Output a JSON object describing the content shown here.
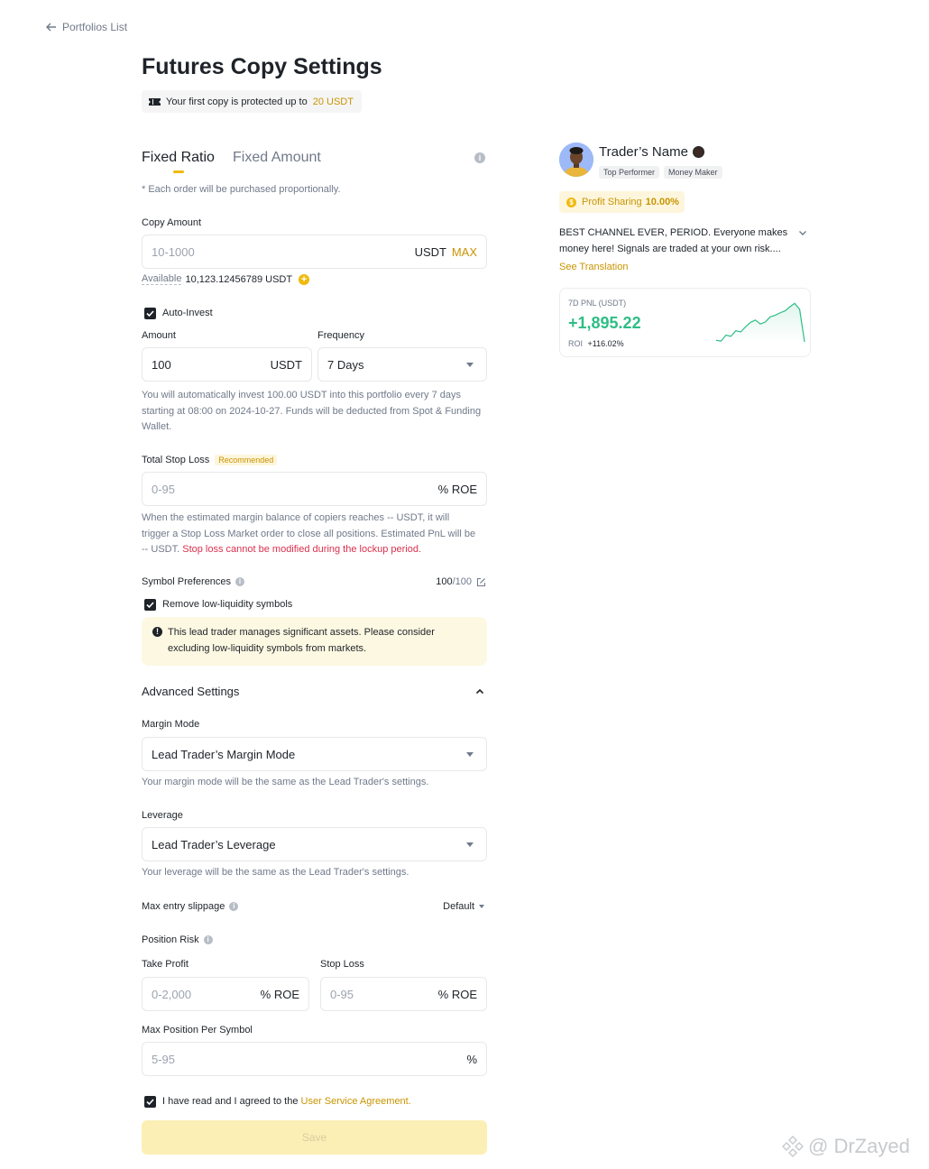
{
  "nav": {
    "back_label": "Portfolios List"
  },
  "page": {
    "title": "Futures Copy Settings",
    "protect_text": "Your first copy is protected up to",
    "protect_amount": "20 USDT"
  },
  "tabs": {
    "active": "Fixed Ratio",
    "inactive": "Fixed Amount"
  },
  "note": "* Each order will be purchased proportionally.",
  "copy_amount": {
    "label": "Copy Amount",
    "placeholder": "10-1000",
    "unit": "USDT",
    "max": "MAX",
    "available_label": "Available",
    "available_value": "10,123.12456789 USDT"
  },
  "auto_invest": {
    "label": "Auto-Invest",
    "amount_label": "Amount",
    "amount_value": "100",
    "amount_unit": "USDT",
    "frequency_label": "Frequency",
    "frequency_value": "7 Days",
    "helper": "You will automatically invest 100.00 USDT into this portfolio every 7 days starting at 08:00 on 2024-10-27. Funds will be deducted from Spot & Funding Wallet."
  },
  "stop_loss": {
    "label": "Total Stop Loss",
    "badge": "Recommended",
    "placeholder": "0-95",
    "unit": "% ROE",
    "helper": "When the estimated margin balance of copiers reaches -- USDT, it will trigger a Stop Loss Market order to close all positions. Estimated PnL will be -- USDT.",
    "warning": "Stop loss cannot be modified during the lockup period."
  },
  "symbols": {
    "label": "Symbol Preferences",
    "count_value": "100",
    "count_total": "/100",
    "remove_label": "Remove low-liquidity symbols",
    "alert_text": "This lead trader manages significant assets. Please consider excluding low-liquidity symbols from markets."
  },
  "advanced": {
    "title": "Advanced Settings",
    "margin_label": "Margin Mode",
    "margin_value": "Lead Trader’s Margin Mode",
    "margin_helper": "Your margin mode will be the same as the Lead Trader's settings.",
    "leverage_label": "Leverage",
    "leverage_value": "Lead Trader’s Leverage",
    "leverage_helper": "Your leverage will be the same as the Lead Trader's settings.",
    "slippage_label": "Max entry slippage",
    "slippage_value": "Default",
    "risk_label": "Position Risk",
    "tp_label": "Take Profit",
    "tp_placeholder": "0-2,000",
    "tp_unit": "% ROE",
    "sl_label": "Stop Loss",
    "sl_placeholder": "0-95",
    "sl_unit": "% ROE",
    "maxpos_label": "Max Position Per Symbol",
    "maxpos_placeholder": "5-95",
    "maxpos_unit": "%"
  },
  "agreement": {
    "text": "I have read and I agreed to the",
    "link": "User Service Agreement."
  },
  "save_label": "Save",
  "trader": {
    "name": "Trader’s Name",
    "tag1": "Top Performer",
    "tag2": "Money Maker",
    "profit_label": "Profit Sharing",
    "profit_value": "10.00%",
    "bio": "BEST CHANNEL EVER, PERIOD. Everyone makes money here! Signals are traded at your own risk....",
    "translate": "See Translation"
  },
  "pnl": {
    "label": "7D PNL (USDT)",
    "value": "+1,895.22",
    "roi_label": "ROI",
    "roi_value": "+116.02%"
  },
  "watermark": "@ DrZayed",
  "colors": {
    "accent": "#c99400",
    "green": "#2ebd85",
    "red": "#d9304e",
    "save_bg": "#fcefb6"
  },
  "chart_data": {
    "type": "area",
    "series": [
      {
        "values": [
          0.04,
          0.02,
          0.17,
          0.14,
          0.28,
          0.25,
          0.38,
          0.49,
          0.55,
          0.45,
          0.5,
          0.63,
          0.67,
          0.73,
          0.78,
          0.88,
          0.97,
          0.82,
          0.0
        ]
      }
    ]
  }
}
